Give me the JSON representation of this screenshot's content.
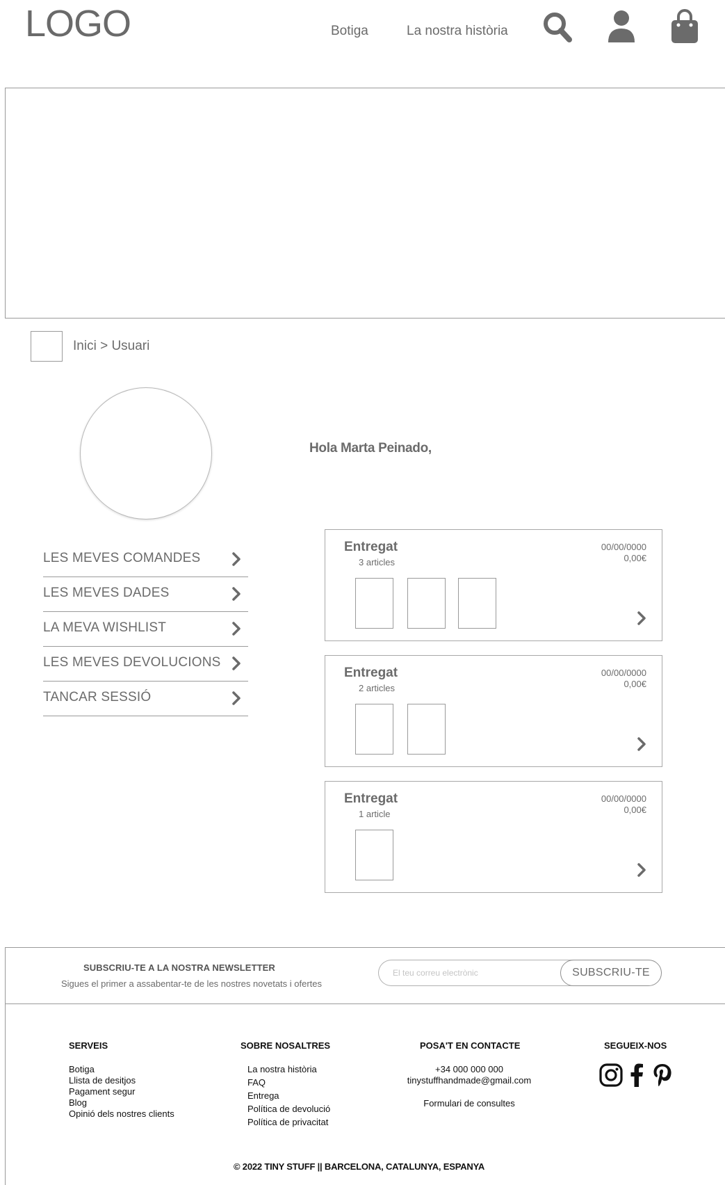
{
  "header": {
    "logo": "LOGO",
    "nav": [
      "Botiga",
      "La nostra història"
    ]
  },
  "breadcrumb": {
    "text": "Inici > Usuari"
  },
  "profile": {
    "greeting": "Hola Marta Peinado,"
  },
  "menu": [
    {
      "label": "LES MEVES COMANDES"
    },
    {
      "label": "LES MEVES DADES"
    },
    {
      "label": "LA MEVA WISHLIST"
    },
    {
      "label": "LES MEVES DEVOLUCIONS"
    },
    {
      "label": "TANCAR SESSIÓ"
    }
  ],
  "orders": [
    {
      "status": "Entregat",
      "count": "3 articles",
      "date": "00/00/0000",
      "price": "0,00€"
    },
    {
      "status": "Entregat",
      "count": "2 articles",
      "date": "00/00/0000",
      "price": "0,00€"
    },
    {
      "status": "Entregat",
      "count": "1 article",
      "date": "00/00/0000",
      "price": "0,00€"
    }
  ],
  "newsletter": {
    "title": "SUBSCRIU-TE A LA NOSTRA NEWSLETTER",
    "subtitle": "Sigues el primer a assabentar-te de les nostres novetats i ofertes",
    "placeholder": "El teu correu electrònic",
    "button": "SUBSCRIU-TE"
  },
  "footer": {
    "serveis": {
      "title": "SERVEIS",
      "links": [
        "Botiga",
        "Llista de desitjos",
        "Pagament segur",
        "Blog",
        "Opinió dels nostres clients"
      ]
    },
    "sobre": {
      "title": "SOBRE NOSALTRES",
      "links": [
        "La nostra història",
        "FAQ",
        "Entrega",
        "Política de devolució",
        "Política de privacitat"
      ]
    },
    "contacte": {
      "title": "POSA'T EN CONTACTE",
      "phone": "+34 000 000 000",
      "email": "tinystuffhandmade@gmail.com",
      "form": "Formulari de consultes"
    },
    "social": {
      "title": "SEGUEIX-NOS",
      "icons": [
        "instagram-icon",
        "facebook-icon",
        "pinterest-icon"
      ]
    },
    "copyright": "© 2022 TINY STUFF || BARCELONA, CATALUNYA, ESPANYA"
  }
}
